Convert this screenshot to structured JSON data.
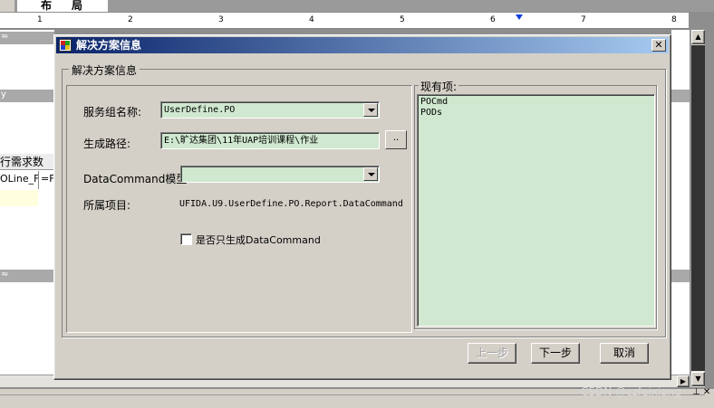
{
  "background": {
    "tab_label": "布局",
    "ruler_numbers": [
      "1",
      "2",
      "3",
      "4",
      "5",
      "6",
      "7",
      "8"
    ],
    "left_panel": {
      "column_header": "行需求数",
      "cell_text": "OLine_F",
      "cell_text_2": "=F"
    }
  },
  "dialog": {
    "title": "解决方案信息",
    "group_title": "解决方案信息",
    "fields": {
      "service_group_label": "服务组名称:",
      "service_group_value": "UserDefine.PO",
      "path_label": "生成路径:",
      "path_value": "E:\\旷达集团\\11年UAP培训课程\\作业",
      "browse_label": "..",
      "datacommand_label": "DataCommand模型:",
      "datacommand_value": "",
      "project_label": "所属项目:",
      "project_value": "UFIDA.U9.UserDefine.PO.Report.DataCommand",
      "only_datacommand_label": "是否只生成DataCommand",
      "only_datacommand_checked": false
    },
    "existing_items": {
      "title": "现有项:",
      "items": [
        "POCmd",
        "PODs"
      ]
    },
    "buttons": {
      "prev": "上一步",
      "next": "下一步",
      "cancel": "取消"
    }
  },
  "watermark": "CSDN @czfeixiang",
  "colors": {
    "title_start": "#0a246a",
    "title_end": "#a6caf0",
    "field_bg": "#cfe8cf",
    "dialog_bg": "#d4d0c8"
  }
}
